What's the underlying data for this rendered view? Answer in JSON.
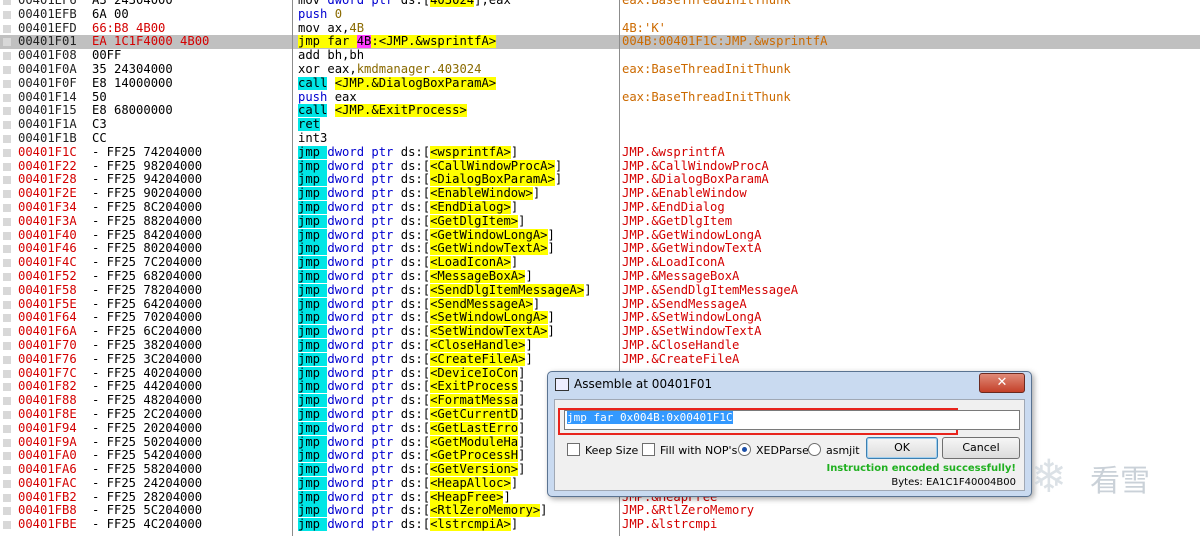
{
  "rows": [
    {
      "addr": "00401EF6",
      "addr_red": false,
      "hex": "A3 24304000",
      "cmt": "eax:BaseThreadInitThunk",
      "asm": [
        {
          "t": "mov ",
          "c": ""
        },
        {
          "t": "dword ptr ",
          "c": "blue"
        },
        {
          "t": "ds:[",
          "c": ""
        },
        {
          "t": "403024",
          "c": "ylw"
        },
        {
          "t": "],eax",
          "c": ""
        }
      ]
    },
    {
      "addr": "00401EFB",
      "addr_red": false,
      "hex": "6A 00",
      "cmt": "",
      "asm": [
        {
          "t": "push ",
          "c": "blue"
        },
        {
          "t": "0",
          "c": "olive"
        }
      ]
    },
    {
      "addr": "00401EFD",
      "addr_red": false,
      "hex": "66:B8 4B00",
      "hex_red": true,
      "cmt": "4B:'K'",
      "asm": [
        {
          "t": "mov ",
          "c": ""
        },
        {
          "t": "ax,",
          "c": ""
        },
        {
          "t": "4B",
          "c": "olive"
        }
      ]
    },
    {
      "addr": "00401F01",
      "addr_red": false,
      "sel": true,
      "hex": "EA 1C1F4000 4B00",
      "hex_red": true,
      "cmt": "004B:00401F1C:JMP.&wsprintfA",
      "asm": [
        {
          "t": "jmp far ",
          "c": "ylw"
        },
        {
          "t": "4B",
          "c": "mag"
        },
        {
          "t": ":",
          "c": "ylw"
        },
        {
          "t": "<JMP.&wsprintfA>",
          "c": "ylw"
        }
      ]
    },
    {
      "addr": "00401F08",
      "addr_red": false,
      "hex": "00FF",
      "cmt": "",
      "asm": [
        {
          "t": "add ",
          "c": ""
        },
        {
          "t": "bh,bh",
          "c": ""
        }
      ]
    },
    {
      "addr": "00401F0A",
      "addr_red": false,
      "hex": "35 24304000",
      "cmt": "eax:BaseThreadInitThunk",
      "asm": [
        {
          "t": "xor ",
          "c": ""
        },
        {
          "t": "eax,",
          "c": ""
        },
        {
          "t": "kmdmanager.403024",
          "c": "olive"
        }
      ]
    },
    {
      "addr": "00401F0F",
      "addr_red": false,
      "hex": "E8 14000000",
      "cmt": "",
      "asm": [
        {
          "t": "call",
          "c": "mn-hl"
        },
        {
          "t": " ",
          "c": ""
        },
        {
          "t": "<JMP.&DialogBoxParamA>",
          "c": "ylw"
        }
      ]
    },
    {
      "addr": "00401F14",
      "addr_red": false,
      "hex": "50",
      "cmt": "eax:BaseThreadInitThunk",
      "asm": [
        {
          "t": "push ",
          "c": "blue"
        },
        {
          "t": "eax",
          "c": ""
        }
      ]
    },
    {
      "addr": "00401F15",
      "addr_red": false,
      "hex": "E8 68000000",
      "cmt": "",
      "asm": [
        {
          "t": "call",
          "c": "mn-hl"
        },
        {
          "t": " ",
          "c": ""
        },
        {
          "t": "<JMP.&ExitProcess>",
          "c": "ylw"
        }
      ]
    },
    {
      "addr": "00401F1A",
      "addr_red": false,
      "hex": "C3",
      "cmt": "",
      "asm": [
        {
          "t": "ret",
          "c": "mn-hl"
        }
      ]
    },
    {
      "addr": "00401F1B",
      "addr_red": false,
      "hex": "CC",
      "cmt": "",
      "asm": [
        {
          "t": "int3",
          "c": ""
        }
      ]
    },
    {
      "addr": "00401F1C",
      "addr_red": true,
      "hex": "- FF25 74204000",
      "cmt": "JMP.&wsprintfA",
      "jmp": "<wsprintfA>"
    },
    {
      "addr": "00401F22",
      "addr_red": true,
      "hex": "- FF25 98204000",
      "cmt": "JMP.&CallWindowProcA",
      "jmp": "<CallWindowProcA>"
    },
    {
      "addr": "00401F28",
      "addr_red": true,
      "hex": "- FF25 94204000",
      "cmt": "JMP.&DialogBoxParamA",
      "jmp": "<DialogBoxParamA>"
    },
    {
      "addr": "00401F2E",
      "addr_red": true,
      "hex": "- FF25 90204000",
      "cmt": "JMP.&EnableWindow",
      "jmp": "<EnableWindow>"
    },
    {
      "addr": "00401F34",
      "addr_red": true,
      "hex": "- FF25 8C204000",
      "cmt": "JMP.&EndDialog",
      "jmp": "<EndDialog>"
    },
    {
      "addr": "00401F3A",
      "addr_red": true,
      "hex": "- FF25 88204000",
      "cmt": "JMP.&GetDlgItem",
      "jmp": "<GetDlgItem>"
    },
    {
      "addr": "00401F40",
      "addr_red": true,
      "hex": "- FF25 84204000",
      "cmt": "JMP.&GetWindowLongA",
      "jmp": "<GetWindowLongA>"
    },
    {
      "addr": "00401F46",
      "addr_red": true,
      "hex": "- FF25 80204000",
      "cmt": "JMP.&GetWindowTextA",
      "jmp": "<GetWindowTextA>"
    },
    {
      "addr": "00401F4C",
      "addr_red": true,
      "hex": "- FF25 7C204000",
      "cmt": "JMP.&LoadIconA",
      "jmp": "<LoadIconA>"
    },
    {
      "addr": "00401F52",
      "addr_red": true,
      "hex": "- FF25 68204000",
      "cmt": "JMP.&MessageBoxA",
      "jmp": "<MessageBoxA>"
    },
    {
      "addr": "00401F58",
      "addr_red": true,
      "hex": "- FF25 78204000",
      "cmt": "JMP.&SendDlgItemMessageA",
      "jmp": "<SendDlgItemMessageA>"
    },
    {
      "addr": "00401F5E",
      "addr_red": true,
      "hex": "- FF25 64204000",
      "cmt": "JMP.&SendMessageA",
      "jmp": "<SendMessageA>"
    },
    {
      "addr": "00401F64",
      "addr_red": true,
      "hex": "- FF25 70204000",
      "cmt": "JMP.&SetWindowLongA",
      "jmp": "<SetWindowLongA>"
    },
    {
      "addr": "00401F6A",
      "addr_red": true,
      "hex": "- FF25 6C204000",
      "cmt": "JMP.&SetWindowTextA",
      "jmp": "<SetWindowTextA>"
    },
    {
      "addr": "00401F70",
      "addr_red": true,
      "hex": "- FF25 38204000",
      "cmt": "JMP.&CloseHandle",
      "jmp": "<CloseHandle>"
    },
    {
      "addr": "00401F76",
      "addr_red": true,
      "hex": "- FF25 3C204000",
      "cmt": "JMP.&CreateFileA",
      "jmp": "<CreateFileA>"
    },
    {
      "addr": "00401F7C",
      "addr_red": true,
      "hex": "- FF25 40204000",
      "cmt": "",
      "jmp": "<DeviceIoCon"
    },
    {
      "addr": "00401F82",
      "addr_red": true,
      "hex": "- FF25 44204000",
      "cmt": "",
      "jmp": "<ExitProcess"
    },
    {
      "addr": "00401F88",
      "addr_red": true,
      "hex": "- FF25 48204000",
      "cmt": "",
      "jmp": "<FormatMessa"
    },
    {
      "addr": "00401F8E",
      "addr_red": true,
      "hex": "- FF25 2C204000",
      "cmt": "",
      "jmp": "<GetCurrentD"
    },
    {
      "addr": "00401F94",
      "addr_red": true,
      "hex": "- FF25 20204000",
      "cmt": "",
      "jmp": "<GetLastErro"
    },
    {
      "addr": "00401F9A",
      "addr_red": true,
      "hex": "- FF25 50204000",
      "cmt": "",
      "jmp": "<GetModuleHa"
    },
    {
      "addr": "00401FA0",
      "addr_red": true,
      "hex": "- FF25 54204000",
      "cmt": "",
      "jmp": "<GetProcessH"
    },
    {
      "addr": "00401FA6",
      "addr_red": true,
      "hex": "- FF25 58204000",
      "cmt": "",
      "jmp": "<GetVersion>"
    },
    {
      "addr": "00401FAC",
      "addr_red": true,
      "hex": "- FF25 24204000",
      "cmt": "",
      "jmp": "<HeapAlloc>"
    },
    {
      "addr": "00401FB2",
      "addr_red": true,
      "hex": "- FF25 28204000",
      "cmt": "JMP.&HeapFree",
      "jmp": "<HeapFree>"
    },
    {
      "addr": "00401FB8",
      "addr_red": true,
      "hex": "- FF25 5C204000",
      "cmt": "JMP.&RtlZeroMemory",
      "jmp": "<RtlZeroMemory>"
    },
    {
      "addr": "00401FBE",
      "addr_red": true,
      "hex": "- FF25 4C204000",
      "cmt": "JMP.&lstrcmpi",
      "jmp": "<lstrcmpiA>"
    }
  ],
  "jmp_prefix": [
    "jmp ",
    "dword ptr ",
    "ds:[",
    "]"
  ],
  "dialog": {
    "title": "Assemble at 00401F01",
    "close_glyph": "✕",
    "input_value": "jmp far 0x004B:0x00401F1C",
    "options": {
      "keep_size": "Keep Size",
      "fill_nops": "Fill with NOP's",
      "xedparse": "XEDParse",
      "asmjit": "asmjit"
    },
    "ok_label": "OK",
    "cancel_label": "Cancel",
    "status": "Instruction encoded successfully!",
    "bytes": "Bytes: EA1C1F40004B00"
  },
  "watermark": {
    "icon": "snowflake-icon",
    "text": "看雪"
  },
  "colors": {
    "accent_red": "#d40000",
    "call_highlight": "#00e6e6",
    "symbol_highlight": "#ffff00",
    "success_green": "#20b020"
  }
}
